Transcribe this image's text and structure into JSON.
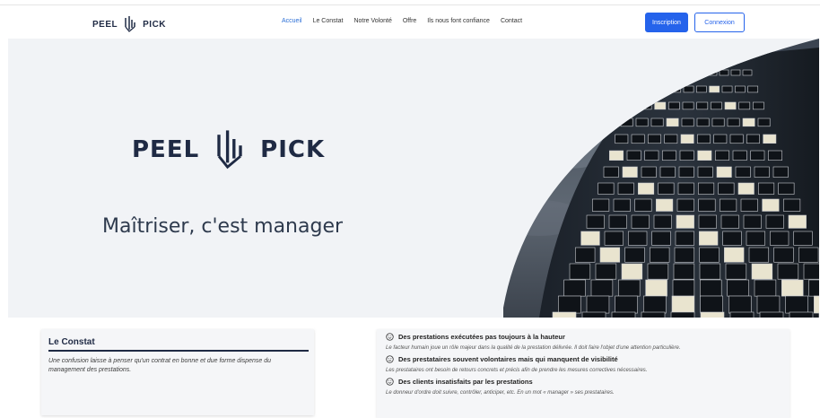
{
  "brand": {
    "name_left": "PEEL",
    "name_right": "PICK"
  },
  "nav": {
    "links": [
      "Accueil",
      "Le Constat",
      "Notre Volonté",
      "Offre",
      "Ils nous font confiance",
      "Contact"
    ],
    "active_index": 0
  },
  "auth": {
    "signup_label": "Inscription",
    "login_label": "Connexion"
  },
  "hero": {
    "logo_left": "PEEL",
    "logo_right": "PICK",
    "tagline": "Maîtriser, c'est manager"
  },
  "constat": {
    "title": "Le Constat",
    "text": "Une confusion laisse à penser qu'un contrat en bonne et due forme dispense du management des prestations."
  },
  "points": [
    {
      "title": "Des prestations exécutées pas toujours à la hauteur",
      "desc": "Le facteur humain joue un rôle majeur dans la qualité de la prestation délivrée. Il doit faire l'objet d'une attention particulière."
    },
    {
      "title": "Des prestataires souvent volontaires mais qui manquent de visibilité",
      "desc": "Les prestataires ont besoin de retours concrets et précis afin de prendre les mesures correctives nécessaires."
    },
    {
      "title": "Des clients insatisfaits par les prestations",
      "desc": "Le donneur d'ordre doit suivre, contrôler, anticiper, etc. En un mot « manager » ses prestataires."
    }
  ],
  "colors": {
    "accent": "#2563eb",
    "navy": "#1f2a44",
    "hero_bg": "#f1f3f6"
  },
  "icons": {
    "logo": "peel-pick-logo-icon",
    "point": "smiley-face-icon"
  }
}
